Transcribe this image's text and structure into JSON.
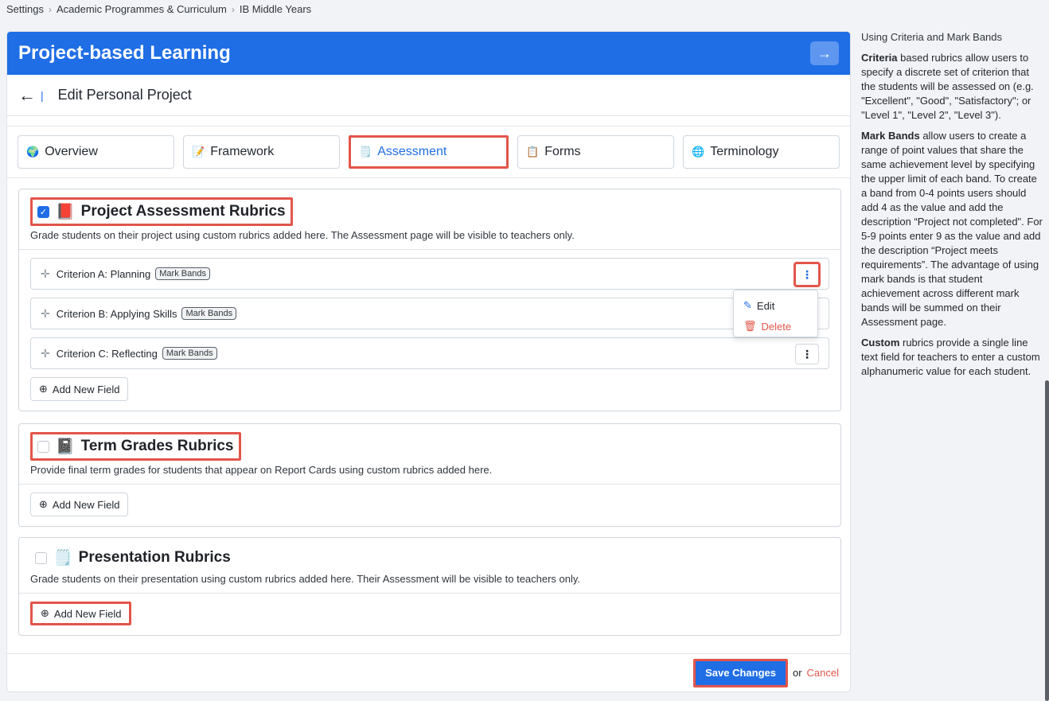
{
  "breadcrumb": [
    "Settings",
    "Academic Programmes & Curriculum",
    "IB Middle Years"
  ],
  "header": {
    "title": "Project-based Learning",
    "action_icon": "arrow-right-icon"
  },
  "subheader": {
    "title": "Edit Personal Project"
  },
  "tabs": [
    {
      "label": "Overview",
      "icon": "🌍"
    },
    {
      "label": "Framework",
      "icon": "📝"
    },
    {
      "label": "Assessment",
      "icon": "🗒️"
    },
    {
      "label": "Forms",
      "icon": "📋"
    },
    {
      "label": "Terminology",
      "icon": "🌐"
    }
  ],
  "sections": [
    {
      "title": "Project Assessment Rubrics",
      "icon": "📕",
      "checked": true,
      "description": "Grade students on their project using custom rubrics added here. The Assessment page will be visible to teachers only.",
      "criteria": [
        {
          "label": "Criterion A: Planning",
          "badge": "Mark Bands"
        },
        {
          "label": "Criterion B: Applying Skills",
          "badge": "Mark Bands"
        },
        {
          "label": "Criterion C: Reflecting",
          "badge": "Mark Bands"
        }
      ],
      "add_label": "Add New Field"
    },
    {
      "title": "Term Grades Rubrics",
      "icon": "📓",
      "checked": false,
      "description": "Provide final term grades for students that appear on Report Cards using custom rubrics added here.",
      "add_label": "Add New Field"
    },
    {
      "title": "Presentation Rubrics",
      "icon": "🗒️",
      "checked": false,
      "description": "Grade students on their presentation using custom rubrics added here. Their Assessment will be visible to teachers only.",
      "add_label": "Add New Field"
    }
  ],
  "dropdown": {
    "edit": "Edit",
    "delete": "Delete"
  },
  "footer": {
    "save": "Save Changes",
    "or": "or",
    "cancel": "Cancel"
  },
  "help": {
    "title": "Using Criteria and Mark Bands",
    "p1_bold": "Criteria",
    "p1": " based rubrics allow users to specify a discrete set of criterion that the students will be assessed on (e.g. \"Excellent\", \"Good\", \"Satisfactory\"; or \"Level 1\", \"Level 2\", \"Level 3\").",
    "p2_bold": "Mark Bands",
    "p2": " allow users to create a range of point values that share the same achievement level by specifying the upper limit of each band. To create a band from 0-4 points users should add 4 as the value and add the description “Project not completed\". For 5-9 points enter 9 as the value and add the description “Project meets requirements”. The advantage of using mark bands is that student achievement across different mark bands will be summed on their Assessment page.",
    "p3_bold": "Custom",
    "p3": " rubrics provide a single line text field for teachers to enter a custom alphanumeric value for each student."
  }
}
